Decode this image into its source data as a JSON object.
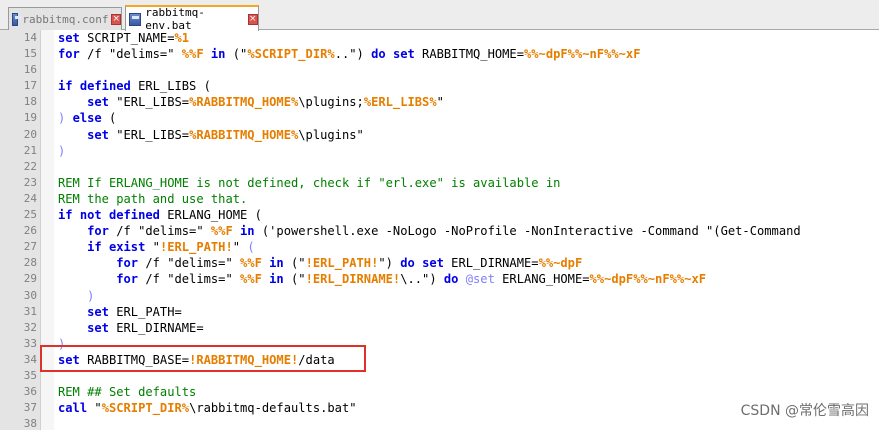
{
  "tabs": [
    {
      "label": "rabbitmq.conf",
      "active": false
    },
    {
      "label": "rabbitmq-env.bat",
      "active": true
    }
  ],
  "lines": [
    {
      "n": "14",
      "t": [
        [
          "kw",
          "set"
        ],
        [
          "plain",
          " SCRIPT_NAME="
        ],
        [
          "var",
          "%1"
        ]
      ]
    },
    {
      "n": "15",
      "t": [
        [
          "kw",
          "for"
        ],
        [
          "plain",
          " /f "
        ],
        [
          "plain",
          "\"delims=\" "
        ],
        [
          "var",
          "%%F"
        ],
        [
          "plain",
          " "
        ],
        [
          "kw",
          "in"
        ],
        [
          "plain",
          " (\""
        ],
        [
          "var",
          "%SCRIPT_DIR%"
        ],
        [
          "plain",
          "..\") "
        ],
        [
          "kw",
          "do"
        ],
        [
          "plain",
          " "
        ],
        [
          "kw",
          "set"
        ],
        [
          "plain",
          " RABBITMQ_HOME="
        ],
        [
          "var",
          "%%~dpF%%~nF%%~xF"
        ]
      ]
    },
    {
      "n": "16",
      "t": []
    },
    {
      "n": "17",
      "t": [
        [
          "kw",
          "if defined"
        ],
        [
          "plain",
          " ERL_LIBS ("
        ]
      ]
    },
    {
      "n": "18",
      "t": [
        [
          "plain",
          "    "
        ],
        [
          "kw",
          "set"
        ],
        [
          "plain",
          " \"ERL_LIBS="
        ],
        [
          "var",
          "%RABBITMQ_HOME%"
        ],
        [
          "plain",
          "\\plugins;"
        ],
        [
          "var",
          "%ERL_LIBS%"
        ],
        [
          "plain",
          "\""
        ]
      ]
    },
    {
      "n": "19",
      "t": [
        [
          "kw2",
          ")"
        ],
        [
          "plain",
          " "
        ],
        [
          "kw",
          "else"
        ],
        [
          "plain",
          " ("
        ]
      ]
    },
    {
      "n": "20",
      "t": [
        [
          "plain",
          "    "
        ],
        [
          "kw",
          "set"
        ],
        [
          "plain",
          " \"ERL_LIBS="
        ],
        [
          "var",
          "%RABBITMQ_HOME%"
        ],
        [
          "plain",
          "\\plugins\""
        ]
      ]
    },
    {
      "n": "21",
      "t": [
        [
          "kw2",
          ")"
        ]
      ]
    },
    {
      "n": "22",
      "t": []
    },
    {
      "n": "23",
      "t": [
        [
          "cmt",
          "REM If ERLANG_HOME is not defined, check if \"erl.exe\" is available in"
        ]
      ]
    },
    {
      "n": "24",
      "t": [
        [
          "cmt",
          "REM the path and use that."
        ]
      ]
    },
    {
      "n": "25",
      "t": [
        [
          "kw",
          "if not defined"
        ],
        [
          "plain",
          " ERLANG_HOME ("
        ]
      ]
    },
    {
      "n": "26",
      "t": [
        [
          "plain",
          "    "
        ],
        [
          "kw",
          "for"
        ],
        [
          "plain",
          " /f \"delims=\" "
        ],
        [
          "var",
          "%%F"
        ],
        [
          "plain",
          " "
        ],
        [
          "kw",
          "in"
        ],
        [
          "plain",
          " ('powershell.exe -NoLogo -NoProfile -NonInteractive -Command \"(Get-Command"
        ]
      ]
    },
    {
      "n": "27",
      "t": [
        [
          "plain",
          "    "
        ],
        [
          "kw",
          "if exist"
        ],
        [
          "plain",
          " \""
        ],
        [
          "var",
          "!ERL_PATH!"
        ],
        [
          "plain",
          "\" "
        ],
        [
          "kw2",
          "("
        ]
      ]
    },
    {
      "n": "28",
      "t": [
        [
          "plain",
          "        "
        ],
        [
          "kw",
          "for"
        ],
        [
          "plain",
          " /f \"delims=\" "
        ],
        [
          "var",
          "%%F"
        ],
        [
          "plain",
          " "
        ],
        [
          "kw",
          "in"
        ],
        [
          "plain",
          " (\""
        ],
        [
          "var",
          "!ERL_PATH!"
        ],
        [
          "plain",
          "\") "
        ],
        [
          "kw",
          "do"
        ],
        [
          "plain",
          " "
        ],
        [
          "kw",
          "set"
        ],
        [
          "plain",
          " ERL_DIRNAME="
        ],
        [
          "var",
          "%%~dpF"
        ]
      ]
    },
    {
      "n": "29",
      "t": [
        [
          "plain",
          "        "
        ],
        [
          "kw",
          "for"
        ],
        [
          "plain",
          " /f \"delims=\" "
        ],
        [
          "var",
          "%%F"
        ],
        [
          "plain",
          " "
        ],
        [
          "kw",
          "in"
        ],
        [
          "plain",
          " (\""
        ],
        [
          "var",
          "!ERL_DIRNAME!"
        ],
        [
          "plain",
          "\\..\") "
        ],
        [
          "kw",
          "do"
        ],
        [
          "plain",
          " "
        ],
        [
          "kw2",
          "@set"
        ],
        [
          "plain",
          " ERLANG_HOME="
        ],
        [
          "var",
          "%%~dpF%%~nF%%~xF"
        ]
      ]
    },
    {
      "n": "30",
      "t": [
        [
          "plain",
          "    "
        ],
        [
          "kw2",
          ")"
        ]
      ]
    },
    {
      "n": "31",
      "t": [
        [
          "plain",
          "    "
        ],
        [
          "kw",
          "set"
        ],
        [
          "plain",
          " ERL_PATH="
        ]
      ]
    },
    {
      "n": "32",
      "t": [
        [
          "plain",
          "    "
        ],
        [
          "kw",
          "set"
        ],
        [
          "plain",
          " ERL_DIRNAME="
        ]
      ]
    },
    {
      "n": "33",
      "t": [
        [
          "kw2",
          ")"
        ]
      ]
    },
    {
      "n": "34",
      "t": [
        [
          "kw",
          "set"
        ],
        [
          "plain",
          " RABBITMQ_BASE="
        ],
        [
          "var",
          "!RABBITMQ_HOME!"
        ],
        [
          "plain",
          "/data"
        ]
      ]
    },
    {
      "n": "35",
      "t": []
    },
    {
      "n": "36",
      "t": [
        [
          "cmt",
          "REM ## Set defaults"
        ]
      ]
    },
    {
      "n": "37",
      "t": [
        [
          "kw",
          "call"
        ],
        [
          "plain",
          " \""
        ],
        [
          "var",
          "%SCRIPT_DIR%"
        ],
        [
          "plain",
          "\\rabbitmq-defaults.bat\""
        ]
      ]
    },
    {
      "n": "38",
      "t": []
    }
  ],
  "watermark": "CSDN @常伦雪高因",
  "colors": {
    "keyword": "#0000e6",
    "variable": "#e67e00",
    "comment": "#008000",
    "highlight_box": "#e0302a"
  }
}
